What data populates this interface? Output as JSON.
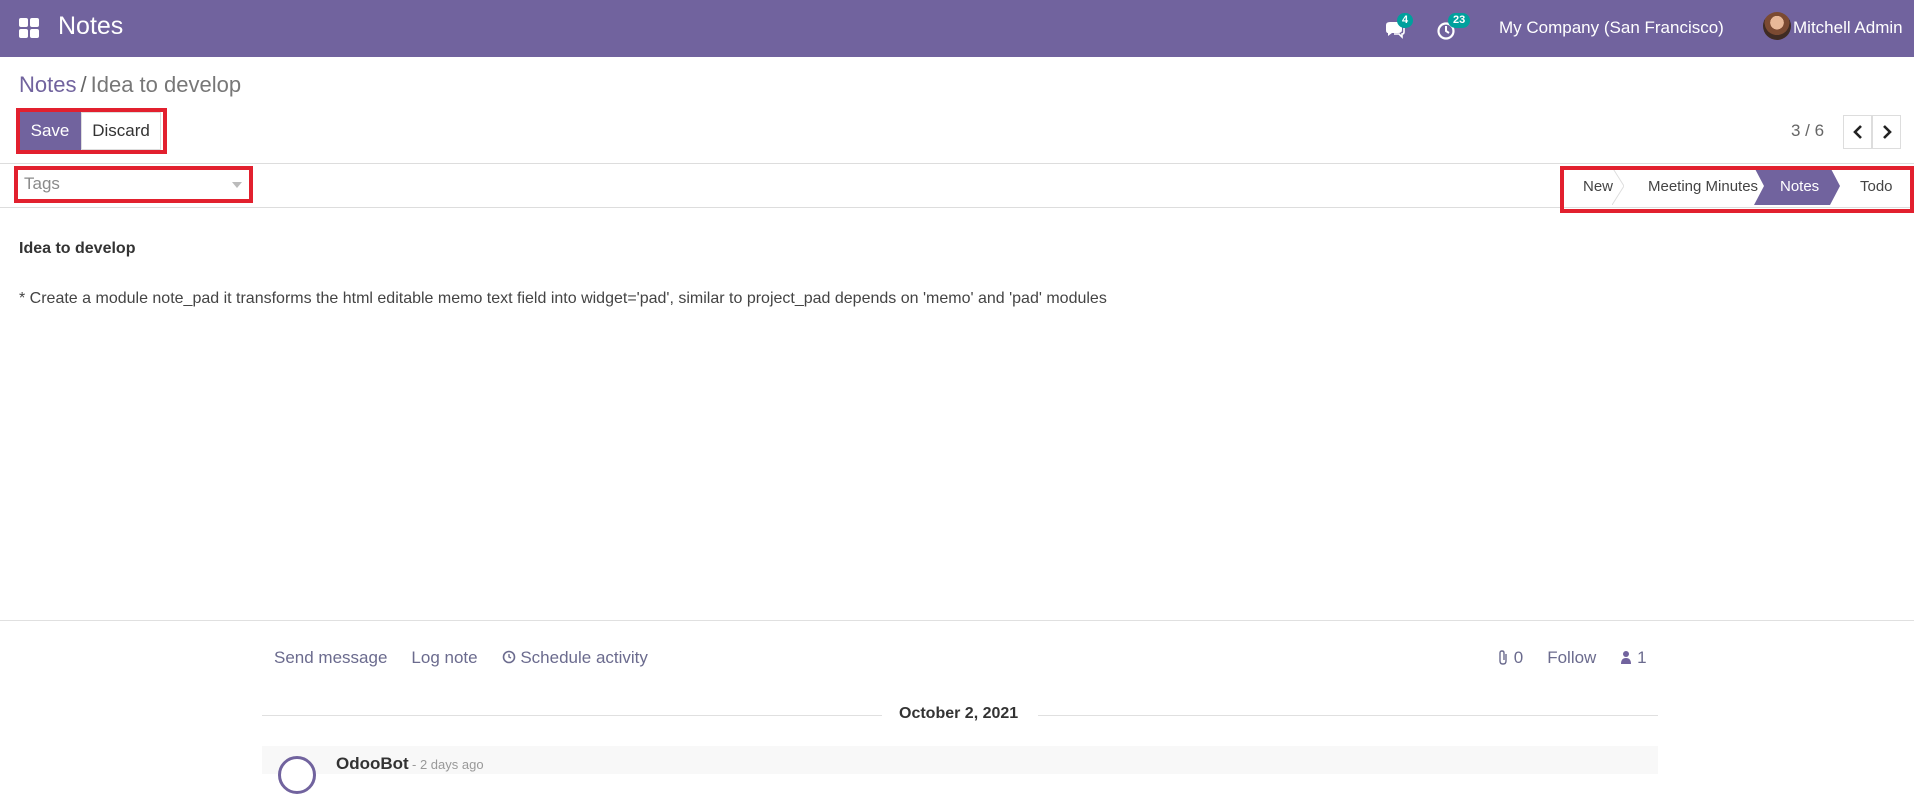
{
  "navbar": {
    "app_title": "Notes",
    "chat_badge": "4",
    "activity_badge": "23",
    "company": "My Company (San Francisco)",
    "user": "Mitchell Admin",
    "accent_color": "#71639e"
  },
  "breadcrumb": {
    "parent": "Notes",
    "separator": "/",
    "current": "Idea to develop"
  },
  "toolbar": {
    "save_label": "Save",
    "discard_label": "Discard"
  },
  "pager": {
    "value": "3 / 6"
  },
  "tags": {
    "placeholder": "Tags"
  },
  "stages": [
    "New",
    "Meeting Minutes",
    "Notes",
    "Todo"
  ],
  "active_stage": "Notes",
  "note": {
    "title": "Idea to develop",
    "body": "* Create a module note_pad it transforms the html editable memo text field into widget='pad', similar to project_pad depends on 'memo' and 'pad' modules"
  },
  "chatter": {
    "send_message": "Send message",
    "log_note": "Log note",
    "schedule_activity": "Schedule activity",
    "attachments": "0",
    "follow": "Follow",
    "followers": "1",
    "date": "October 2, 2021",
    "author": "OdooBot",
    "time": "- 2 days ago"
  }
}
